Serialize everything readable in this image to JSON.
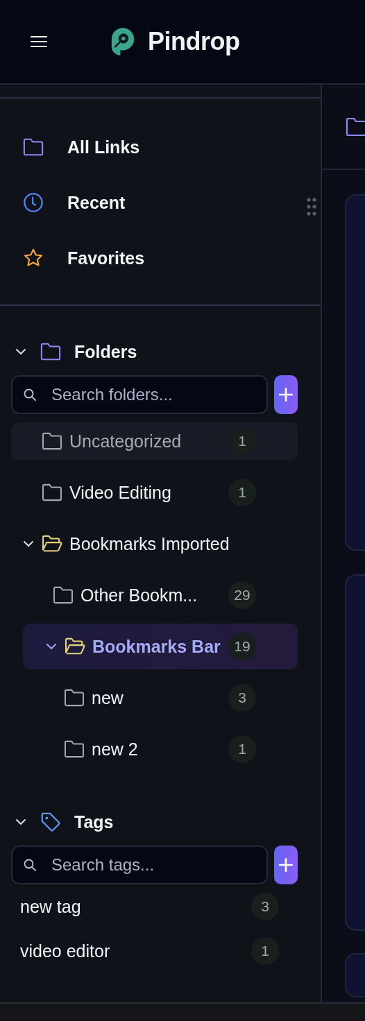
{
  "header": {
    "title": "Pindrop"
  },
  "nav": [
    {
      "label": "All Links",
      "kind": "folder"
    },
    {
      "label": "Recent",
      "kind": "clock"
    },
    {
      "label": "Favorites",
      "kind": "star"
    }
  ],
  "folders": {
    "title": "Folders",
    "expanded": true,
    "search": {
      "placeholder": "Search folders..."
    },
    "items": [
      {
        "name": "Uncategorized",
        "count": "1",
        "selected": false,
        "highlighted": true
      },
      {
        "name": "Video Editing",
        "count": "1",
        "selected": false,
        "highlighted": false
      },
      {
        "name": "Bookmarks Imported",
        "selected": false,
        "highlighted": false,
        "expanded": true,
        "children": [
          {
            "name": "Other Bookm...",
            "count": "29",
            "selected": false,
            "highlighted": false
          },
          {
            "name": "Bookmarks Bar",
            "count": "19",
            "selected": true,
            "highlighted": false,
            "expanded": true,
            "children": [
              {
                "name": "new",
                "count": "3",
                "selected": false,
                "highlighted": false
              },
              {
                "name": "new 2",
                "count": "1",
                "selected": false,
                "highlighted": false
              }
            ]
          }
        ]
      }
    ]
  },
  "tags": {
    "title": "Tags",
    "expanded": true,
    "search": {
      "placeholder": "Search tags..."
    },
    "items": [
      {
        "name": "new tag",
        "count": "3"
      },
      {
        "name": "video editor",
        "count": "1"
      }
    ]
  }
}
